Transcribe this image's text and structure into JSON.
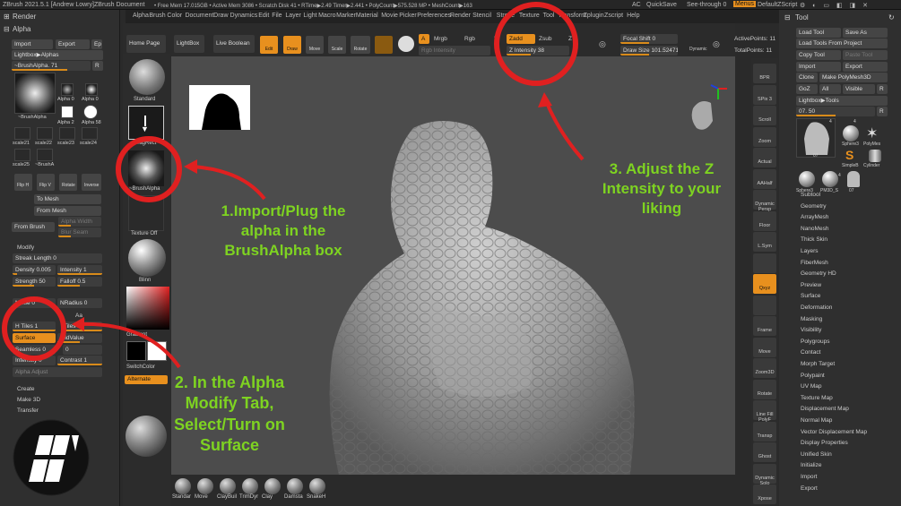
{
  "title_bar": {
    "app": "ZBrush 2021.5.1 [Andrew Lowry]",
    "document": "ZBrush Document",
    "stats": "• Free Mem 17.015GB • Active Mem 3086 • Scratch Disk 41 • RTime▶2.49 Timer▶2.441 • PolyCount▶575.528 MP • MeshCount▶163",
    "ac": "AC",
    "quicksave": "QuickSave",
    "seethrough": "See-through  0",
    "menus": "Menus",
    "zscript": "DefaultZScript"
  },
  "menubar": [
    "Alpha",
    "Brush",
    "Color",
    "Document",
    "Draw",
    "Dynamics",
    "Edit",
    "File",
    "Layer",
    "Light",
    "Macro",
    "Marker",
    "Material",
    "Movie",
    "Picker",
    "Preferences",
    "Render",
    "Stencil",
    "Stroke",
    "Texture",
    "Tool",
    "Transform",
    "Zplugin",
    "Zscript",
    "Help"
  ],
  "left_panel": {
    "render_title": "Render",
    "alpha_title": "Alpha",
    "import": "Import",
    "export": "Export",
    "ep": "Ep",
    "lightbox_alphas": "Lightbox▶Alphas",
    "brush_alpha_slider": "~BrushAlpha. 71",
    "r_label": "R",
    "brushalpha_thumb": "~BrushAlpha",
    "alpha0": "Alpha 0",
    "alpha0b": "Alpha 0",
    "alpha2": "Alpha 2",
    "alpha58": "Alpha 58",
    "alpha_grid": [
      "scale21",
      "scale22",
      "scale23",
      "scale24",
      "scale25",
      "~BrushA"
    ],
    "flip_h": "Flip H",
    "flip_v": "Flip V",
    "rotate": "Rotate",
    "inverse": "Inverse",
    "to_mesh": "To Mesh",
    "from_mesh": "From Mesh",
    "alpha_width": "Alpha Width",
    "blur_seam": "Blur Seam",
    "from_brush": "From Brush",
    "modify": "Modify",
    "streak_length": "Streak Length 0",
    "density": "Density 0.005",
    "intensity_top": "Intensity 1",
    "strength": "Strength 50",
    "falloff": "Falloff 0.5",
    "noise": "Noise 0",
    "nradius": "NRadius 0",
    "aa": "Aa",
    "h_tiles": "H Tiles 1",
    "v_tiles": "Tiles 1",
    "surface": "Surface",
    "midvalue": "MidValue",
    "seamless": "Seamless 0",
    "seam_val": "0",
    "intensity": "Intensity 0",
    "contrast": "Contrast 1",
    "alpha_adjust": "Alpha Adjust",
    "create": "Create",
    "make3d": "Make 3D",
    "transfer": "Transfer"
  },
  "shelf": {
    "home_page": "Home Page",
    "lightbox": "LightBox",
    "live_boolean": "Live Boolean",
    "standard": "Standard",
    "dragrect": "DragRect",
    "brushalpha": "~BrushAlpha",
    "texture_off": "Texture Off",
    "blinn": "Blinn",
    "gradient": "Gradient",
    "switchcolor": "SwitchColor",
    "alternate": "Alternate"
  },
  "top_tools": {
    "edit": "Edit",
    "draw": "Draw",
    "move": "Move",
    "scale": "Scale",
    "rotate": "Rotate",
    "a": "A",
    "mrgb": "Mrgb",
    "rgb": "Rgb",
    "m": "M",
    "zadd": "Zadd",
    "zsub": "Zsub",
    "zcut": "Z",
    "rgb_intensity": "Rgb Intensity",
    "z_intensity": "Z Intensity 38",
    "focal_shift": "Focal Shift 0",
    "draw_size": "Draw Size 101.52471",
    "dynamic": "Dynamic",
    "active_points": "ActivePoints: 11",
    "total_points": "TotalPoints: 11"
  },
  "right_shelf": [
    "BPR",
    "SPix 3",
    "Scroll",
    "Zoom",
    "Actual",
    "AAHalf",
    "Dynamic Persp",
    "Floor",
    "L.Sym",
    "",
    "Qxyz",
    "",
    "Frame",
    "Move",
    "Zoom3D",
    "Rotate",
    "Line Fill PolyF",
    "Transp",
    "Ghost",
    "Dynamic Solo",
    "Xpose"
  ],
  "right_panel": {
    "tool_title": "Tool",
    "load_tool": "Load Tool",
    "save_as": "Save As",
    "load_from_project": "Load Tools From Project",
    "copy_tool": "Copy Tool",
    "paste_tool": "Paste Tool",
    "import": "Import",
    "export": "Export",
    "clone": "Clone",
    "make_polymesh": "Make PolyMesh3D",
    "goz": "GoZ",
    "all": "All",
    "visible": "Visible",
    "r": "R",
    "lightbox_tools": "Lightbox▶Tools",
    "tool_slider": "07. 50",
    "thumb_labels": [
      "07",
      "Sphere3",
      "PolyMes",
      "SimpleB",
      "Cylinder",
      "Sphere3",
      "PM3D_S",
      "07"
    ],
    "thumb_nums": [
      "4",
      "4",
      "4"
    ],
    "menu": [
      "Subtool",
      "Geometry",
      "ArrayMesh",
      "NanoMesh",
      "Thick Skin",
      "Layers",
      "FiberMesh",
      "Geometry HD",
      "Preview",
      "Surface",
      "Deformation",
      "Masking",
      "Visibility",
      "Polygroups",
      "Contact",
      "Morph Target",
      "Polypaint",
      "UV Map",
      "Texture Map",
      "Displacement Map",
      "Normal Map",
      "Vector Displacement Map",
      "Display Properties",
      "Unified Skin",
      "Initialize",
      "Import",
      "Export"
    ]
  },
  "bottom_brushes": [
    "Standar",
    "Move",
    "ClayBuil",
    "TrimDyr",
    "Clay",
    "Damsta",
    "SnakeH"
  ],
  "annotations": {
    "a1": "1.Import/Plug the alpha in the BrushAlpha box",
    "a2": "2. In the Alpha Modify Tab, Select/Turn on Surface",
    "a3": "3. Adjust the Z Intensity to your liking"
  },
  "colors": {
    "accent": "#e8901e",
    "annotation_green": "#7ed321",
    "annotation_red": "#e02020"
  }
}
